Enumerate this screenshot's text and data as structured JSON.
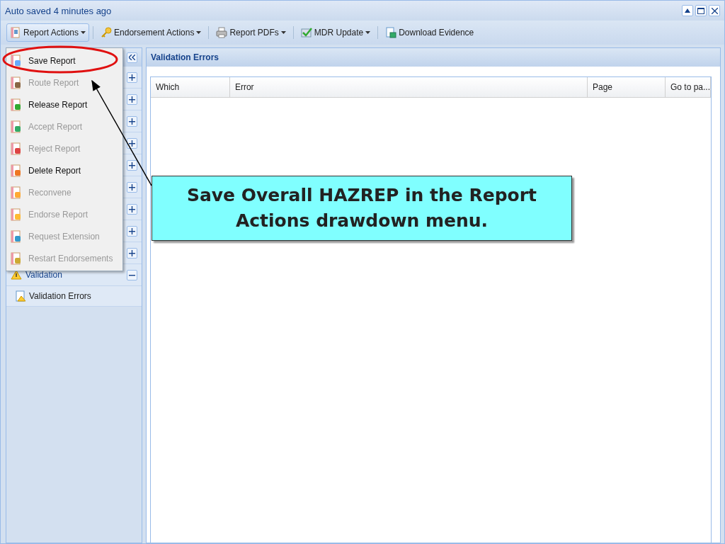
{
  "window": {
    "title": "Auto saved 4 minutes ago"
  },
  "toolbar": [
    {
      "label": "Report Actions",
      "has_dropdown": true,
      "selected": true
    },
    {
      "label": "Endorsement Actions",
      "has_dropdown": true,
      "selected": false
    },
    {
      "label": "Report PDFs",
      "has_dropdown": true,
      "selected": false
    },
    {
      "label": "MDR Update",
      "has_dropdown": true,
      "selected": false
    },
    {
      "label": "Download Evidence",
      "has_dropdown": false,
      "selected": false
    }
  ],
  "sidebar": {
    "sections": [
      {
        "expanded": false
      },
      {
        "expanded": false
      },
      {
        "expanded": false
      },
      {
        "expanded": false
      },
      {
        "expanded": false
      },
      {
        "expanded": false
      },
      {
        "expanded": false
      },
      {
        "expanded": false
      },
      {
        "expanded": false
      },
      {
        "label": "Validation",
        "expanded": true,
        "children": [
          {
            "label": "Validation Errors"
          }
        ]
      }
    ]
  },
  "menu": {
    "items": [
      {
        "label": "Save Report",
        "disabled": false
      },
      {
        "label": "Route Report",
        "disabled": true
      },
      {
        "label": "Release Report",
        "disabled": false
      },
      {
        "label": "Accept Report",
        "disabled": true
      },
      {
        "label": "Reject Report",
        "disabled": true
      },
      {
        "label": "Delete Report",
        "disabled": false
      },
      {
        "label": "Reconvene",
        "disabled": true
      },
      {
        "label": "Endorse Report",
        "disabled": true
      },
      {
        "label": "Request Extension",
        "disabled": true
      },
      {
        "label": "Restart Endorsements",
        "disabled": true
      }
    ]
  },
  "panel": {
    "title": "Validation Errors",
    "columns": [
      "Which",
      "Error",
      "Page",
      "Go to pa..."
    ]
  },
  "callout": {
    "text": "Save Overall HAZREP in the Report Actions drawdown menu."
  }
}
